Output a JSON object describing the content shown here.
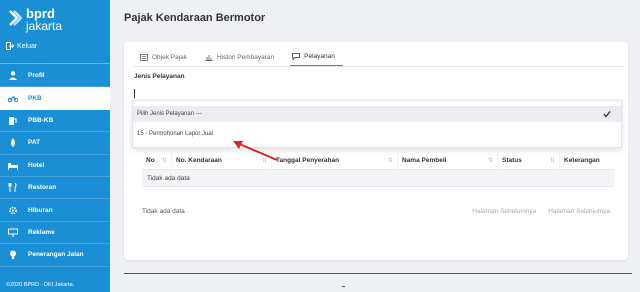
{
  "brand": {
    "line1": "bprd",
    "line2": "jakarta"
  },
  "sidebar": {
    "logout_label": "Keluar",
    "items": [
      {
        "label": "Profil",
        "icon": "user-icon",
        "active": false
      },
      {
        "label": "PKB",
        "icon": "motorcycle-icon",
        "active": true
      },
      {
        "label": "PBB-KB",
        "icon": "fuel-icon",
        "active": false
      },
      {
        "label": "PAT",
        "icon": "water-drop-icon",
        "active": false
      },
      {
        "label": "Hotel",
        "icon": "bed-icon",
        "active": false
      },
      {
        "label": "Restoran",
        "icon": "utensils-icon",
        "active": false
      },
      {
        "label": "Hiburan",
        "icon": "gear-icon",
        "active": false
      },
      {
        "label": "Reklame",
        "icon": "billboard-icon",
        "active": false
      },
      {
        "label": "Penerangan Jalan",
        "icon": "lightbulb-icon",
        "active": false
      }
    ],
    "footer": "©2020 BPRD - DKI Jakarta."
  },
  "page": {
    "title": "Pajak Kendaraan Bermotor"
  },
  "tabs": [
    {
      "label": "Objek Pajak",
      "icon": "list-icon"
    },
    {
      "label": "Histori Pembayaran",
      "icon": "chart-icon"
    },
    {
      "label": "Pelayanan",
      "icon": "chat-icon"
    }
  ],
  "form": {
    "label": "Jenis Pelayanan",
    "options": [
      "Pilih Jenis Pelayanan ---",
      "15 - Permohonan Lapor Jual"
    ]
  },
  "table": {
    "headers": [
      "No",
      "No. Kendaraan",
      "Tanggal Penyerahan",
      "Nama Pembeli",
      "Status",
      "Keterangan"
    ],
    "empty_row": "Tidak ada data"
  },
  "footer_info": "Tidak ada data",
  "pager": {
    "prev": "Halaman Sebelumnya",
    "next": "Halaman Selanjutnya"
  },
  "colors": {
    "primary": "#1a8fd6",
    "annotation": "#d9262b"
  }
}
